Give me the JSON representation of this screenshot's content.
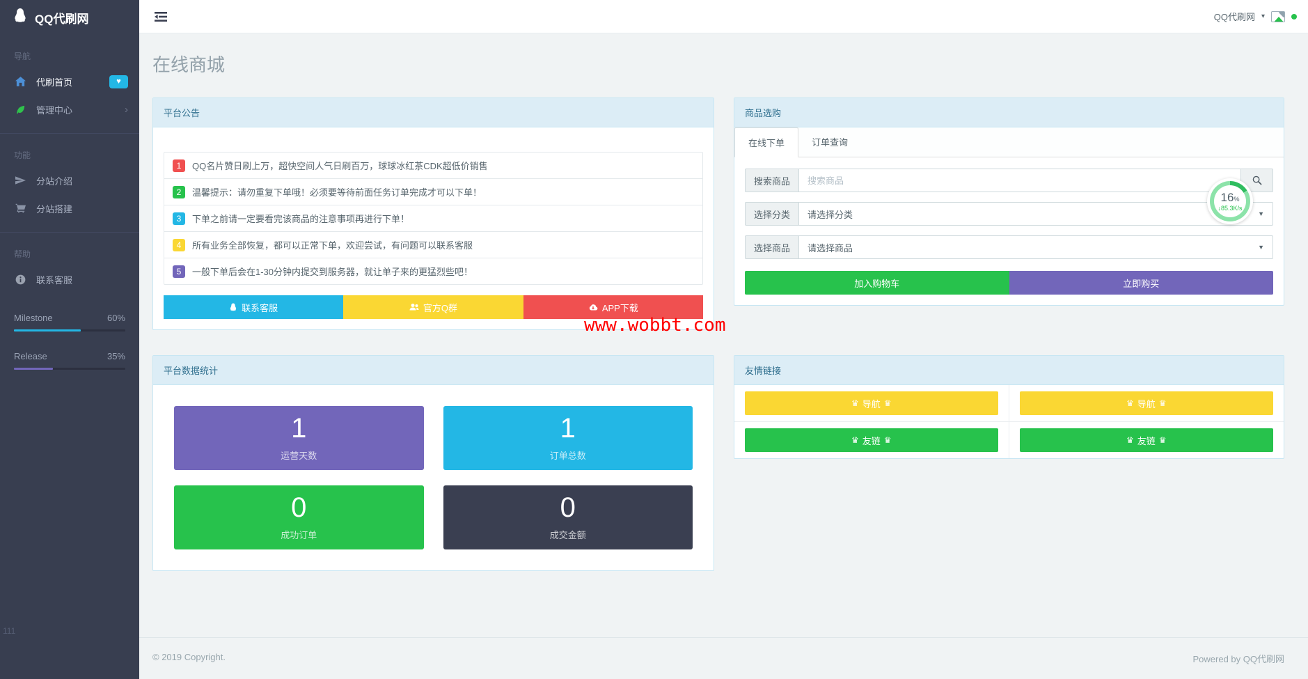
{
  "brand": {
    "title": "QQ代刷网"
  },
  "topbar": {
    "user_menu": "QQ代刷网"
  },
  "icons": {
    "heart": "♥",
    "chevron_right": "›",
    "caret_down": "▾",
    "select_caret": "▼",
    "crown": "♛",
    "down_arrow": "↓"
  },
  "sidebar": {
    "sections": [
      {
        "label": "导航",
        "items": [
          {
            "label": "代刷首页",
            "icon": "home-icon",
            "badge": "heart"
          },
          {
            "label": "管理中心",
            "icon": "leaf-icon",
            "chevron": true
          }
        ]
      },
      {
        "label": "功能",
        "items": [
          {
            "label": "分站介绍",
            "icon": "paper-plane-icon"
          },
          {
            "label": "分站搭建",
            "icon": "cart-icon"
          }
        ]
      },
      {
        "label": "帮助",
        "items": [
          {
            "label": "联系客服",
            "icon": "info-icon"
          }
        ]
      }
    ],
    "progress": [
      {
        "label": "Milestone",
        "value": "60%",
        "color": "#23b7e5"
      },
      {
        "label": "Release",
        "value": "35%",
        "color": "#7266ba"
      }
    ],
    "footnote": "111"
  },
  "page": {
    "title": "在线商城"
  },
  "announcements": {
    "panel_title": "平台公告",
    "items": [
      {
        "num": "1",
        "color": "#f05050",
        "text": "QQ名片赞日刷上万，超快空间人气日刷百万，球球冰红茶CDK超低价销售"
      },
      {
        "num": "2",
        "color": "#27c24c",
        "text": "温馨提示：请勿重复下单哦！必须要等待前面任务订单完成才可以下单！"
      },
      {
        "num": "3",
        "color": "#23b7e5",
        "text": "下单之前请一定要看完该商品的注意事项再进行下单！"
      },
      {
        "num": "4",
        "color": "#fad733",
        "text": "所有业务全部恢复，都可以正常下单，欢迎尝试，有问题可以联系客服"
      },
      {
        "num": "5",
        "color": "#7266ba",
        "text": "一般下单后会在1-30分钟内提交到服务器，就让单子来的更猛烈些吧！"
      }
    ],
    "buttons": [
      {
        "label": "联系客服",
        "color": "#23b7e5",
        "icon": "qq-penguin-icon"
      },
      {
        "label": "官方Q群",
        "color": "#fad733",
        "icon": "users-icon"
      },
      {
        "label": "APP下载",
        "color": "#f05050",
        "icon": "cloud-download-icon"
      }
    ]
  },
  "watermark": "www.wobbt.com",
  "shop": {
    "panel_title": "商品选购",
    "tabs": [
      {
        "label": "在线下单",
        "active": true
      },
      {
        "label": "订单查询",
        "active": false
      }
    ],
    "search": {
      "label": "搜索商品",
      "placeholder": "搜索商品"
    },
    "category": {
      "label": "选择分类",
      "value": "请选择分类"
    },
    "product": {
      "label": "选择商品",
      "value": "请选择商品"
    },
    "add_to_cart": "加入购物车",
    "buy_now": "立即购买",
    "gauge": {
      "percent": "16",
      "unit": "%",
      "speed": "85.3K/s"
    }
  },
  "stats": {
    "panel_title": "平台数据统计",
    "cards": [
      {
        "value": "1",
        "label": "运营天数",
        "color": "#7266ba"
      },
      {
        "value": "1",
        "label": "订单总数",
        "color": "#23b7e5"
      },
      {
        "value": "0",
        "label": "成功订单",
        "color": "#27c24c"
      },
      {
        "value": "0",
        "label": "成交金额",
        "color": "#3a3f51"
      }
    ]
  },
  "links": {
    "panel_title": "友情链接",
    "buttons": [
      {
        "label": "导航",
        "color": "#fad733"
      },
      {
        "label": "导航",
        "color": "#fad733"
      },
      {
        "label": "友链",
        "color": "#27c24c"
      },
      {
        "label": "友链",
        "color": "#27c24c"
      }
    ]
  },
  "footer": {
    "left": "© 2019 Copyright.",
    "right": "Powered by QQ代刷网"
  }
}
